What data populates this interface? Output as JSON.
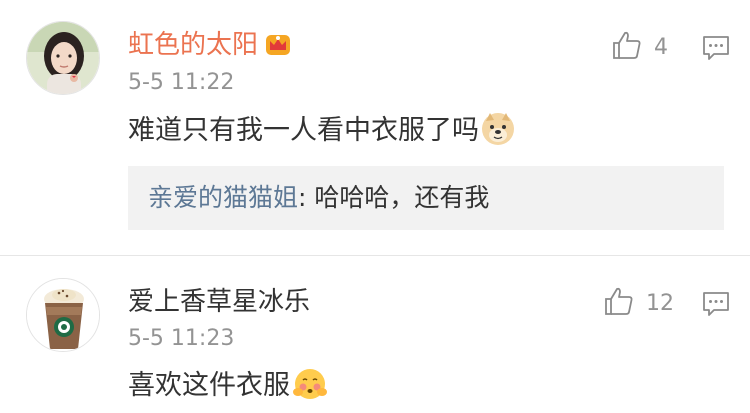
{
  "comments": [
    {
      "username": "虹色的太阳",
      "badge_icon": "vip-crown-icon",
      "time": "5-5 11:22",
      "text": "难道只有我一人看中衣服了吗",
      "emoji": "doge-emoji",
      "likes": "4",
      "reply": {
        "author": "亲爱的猫猫姐",
        "separator": ":",
        "text": " 哈哈哈，还有我"
      }
    },
    {
      "username": "爱上香草星冰乐",
      "time": "5-5 11:23",
      "text": "喜欢这件衣服",
      "emoji": "shy-face-emoji",
      "likes": "12"
    }
  ],
  "colors": {
    "vip_name": "#eb7350",
    "reply_author": "#5d7895",
    "muted": "#939393",
    "reply_bg": "#f2f2f2"
  }
}
